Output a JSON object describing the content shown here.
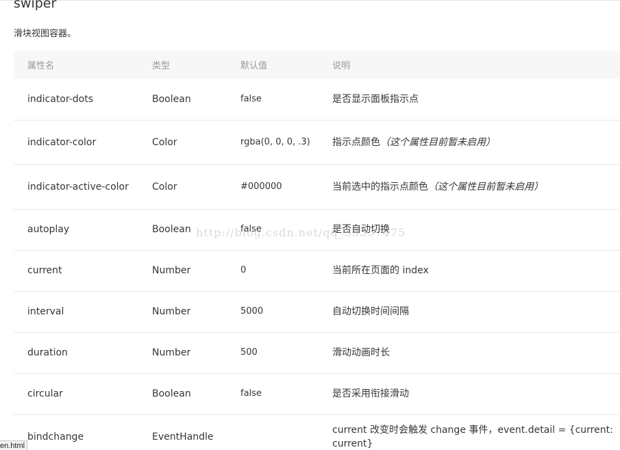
{
  "heading": "swiper",
  "description": "滑块视图容器。",
  "table": {
    "headers": [
      "属性名",
      "类型",
      "默认值",
      "说明"
    ],
    "rows": [
      {
        "name": "indicator-dots",
        "type": "Boolean",
        "default": "false",
        "desc": "是否显示面板指示点",
        "note": ""
      },
      {
        "name": "indicator-color",
        "type": "Color",
        "default": "rgba(0, 0, 0, .3)",
        "desc": "指示点颜色",
        "note": "（这个属性目前暂未启用）"
      },
      {
        "name": "indicator-active-color",
        "type": "Color",
        "default": "#000000",
        "desc": "当前选中的指示点颜色",
        "note": "（这个属性目前暂未启用）"
      },
      {
        "name": "autoplay",
        "type": "Boolean",
        "default": "false",
        "desc": "是否自动切换",
        "note": ""
      },
      {
        "name": "current",
        "type": "Number",
        "default": "0",
        "desc": "当前所在页面的 index",
        "note": ""
      },
      {
        "name": "interval",
        "type": "Number",
        "default": "5000",
        "desc": "自动切换时间间隔",
        "note": ""
      },
      {
        "name": "duration",
        "type": "Number",
        "default": "500",
        "desc": "滑动动画时长",
        "note": ""
      },
      {
        "name": "circular",
        "type": "Boolean",
        "default": "false",
        "desc": "是否采用衔接滑动",
        "note": ""
      },
      {
        "name": "bindchange",
        "type": "EventHandle",
        "default": "",
        "desc": "current 改变时会触发 change 事件，event.detail = {current: current}",
        "note": ""
      }
    ]
  },
  "watermark": "http://blog.csdn.net/qq_33337475",
  "status_link": "en.html"
}
